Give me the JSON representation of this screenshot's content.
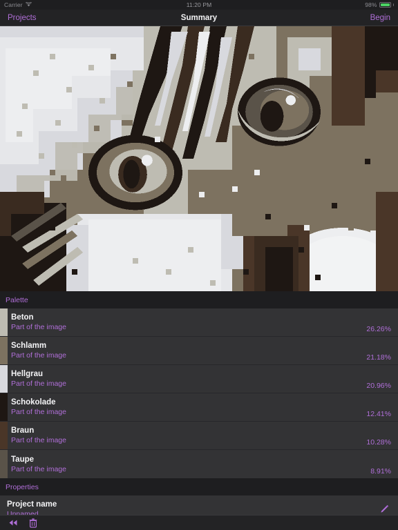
{
  "status_bar": {
    "carrier": "Carrier",
    "wifi_icon": "wifi-icon",
    "time": "11:20 PM",
    "battery_percent": "98%",
    "battery_icon": "battery-icon"
  },
  "nav_bar": {
    "back_label": "Projects",
    "title": "Summary",
    "action_label": "Begin"
  },
  "preview": {
    "name": "pixelated-cat-preview",
    "alt": "Pixelated cat photo rendered in palette colors"
  },
  "palette_section": {
    "header": "Palette",
    "items": [
      {
        "name": "Beton",
        "subtitle": "Part of the image",
        "percent": "26.26%",
        "color": "#bebcb2"
      },
      {
        "name": "Schlamm",
        "subtitle": "Part of the image",
        "percent": "21.18%",
        "color": "#7d7260"
      },
      {
        "name": "Hellgrau",
        "subtitle": "Part of the image",
        "percent": "20.96%",
        "color": "#d8d9de"
      },
      {
        "name": "Schokolade",
        "subtitle": "Part of the image",
        "percent": "12.41%",
        "color": "#1e1713"
      },
      {
        "name": "Braun",
        "subtitle": "Part of the image",
        "percent": "10.28%",
        "color": "#4a3628"
      },
      {
        "name": "Taupe",
        "subtitle": "Part of the image",
        "percent": "8.91%",
        "color": "#5a5349"
      }
    ]
  },
  "properties_section": {
    "header": "Properties",
    "project_name_label": "Project name",
    "project_name_value": "Unnamed",
    "edit_icon": "pencil-icon"
  },
  "toolbar": {
    "rewind_icon": "rewind-icon",
    "delete_icon": "trash-icon"
  },
  "theme": {
    "accent": "#b06fd8",
    "background": "#1c1c1e",
    "row_background": "#333335",
    "battery_green": "#4cd264"
  }
}
